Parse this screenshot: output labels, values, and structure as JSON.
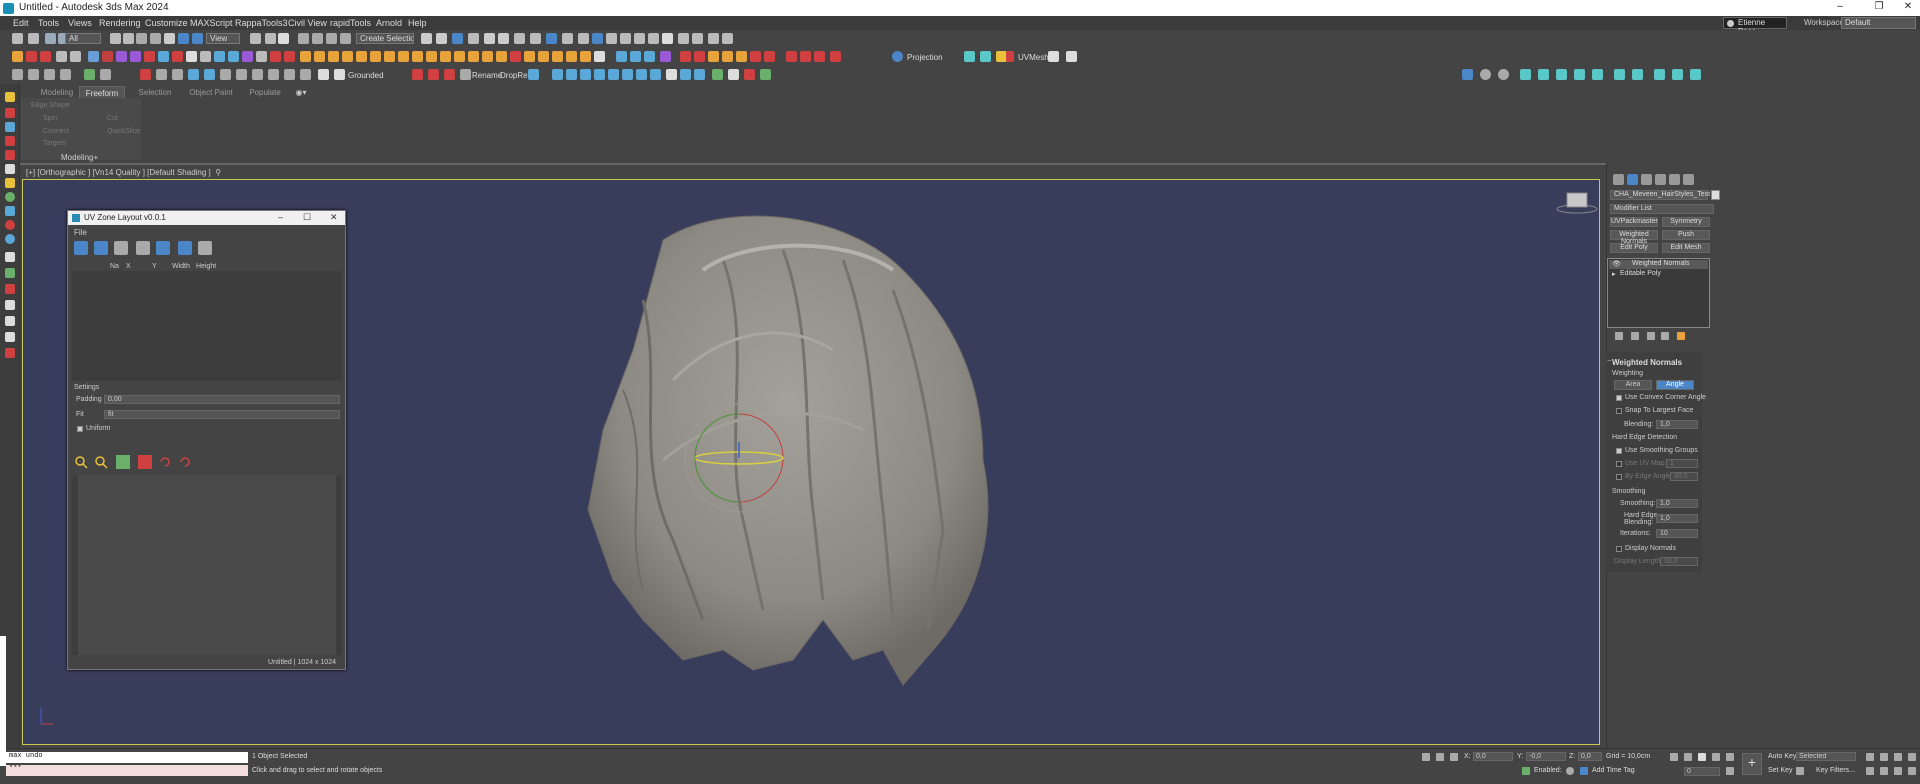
{
  "window": {
    "title": "Untitled - Autodesk 3ds Max 2024",
    "minimize": "–",
    "maximize": "❐",
    "close": "✕"
  },
  "menu": {
    "items": [
      "Edit",
      "Tools",
      "Views",
      "Rendering",
      "Customize",
      "MAXScript",
      "RappaTools3",
      "Civil View",
      "rapidTools",
      "Arnold",
      "Help"
    ],
    "user": "Etienne Besc...",
    "workspaces_label": "Workspaces:",
    "workspace": "Default"
  },
  "toolbar": {
    "filter": "All",
    "refcoord": "View",
    "selection_set": "Create Selection Se",
    "projection": "Projection",
    "uvmesh": "UVMesh",
    "grounded": "Grounded",
    "rename": "Rename",
    "dropref": "DropRef"
  },
  "ribbon": {
    "tabs": [
      "Modeling",
      "Freeform",
      "Selection",
      "Object Paint",
      "Populate"
    ],
    "active_tab": "Freeform",
    "items": [
      "Edge Shape",
      "Spin",
      "Cut",
      "Connect",
      "QuickSlice",
      "Targets"
    ],
    "footer": "Modeling+"
  },
  "viewport": {
    "label": "[+] [Orthographic ] [Vn14 Quality ] [Default Shading ]",
    "label_extra": "⚲"
  },
  "uv_window": {
    "title": "UV Zone Layout v0.0.1",
    "menu_file": "File",
    "columns": [
      "Na",
      "X",
      "Y",
      "Width",
      "Height"
    ],
    "settings_label": "Settings",
    "padding_label": "Padding",
    "padding_value": "0,00",
    "fit_label": "Fit",
    "fit_value": "fit",
    "uniform_label": "Uniform",
    "status": "Untitled | 1024 x 1024"
  },
  "command_panel": {
    "object_name": "CHA_Meveen_HairStyles_Test",
    "modifier_list": "Modifier List",
    "buttons": [
      "UVPackmaster",
      "Symmetry",
      "Weighted Normals",
      "Push",
      "Edit Poly",
      "Edit Mesh"
    ],
    "stack": [
      "Weighted Normals",
      "Editable Poly"
    ]
  },
  "weighted_normals": {
    "title": "Weighted Normals",
    "weighting": "Weighting",
    "area": "Area",
    "angle": "Angle",
    "convex": "Use Convex Corner Angle",
    "snap": "Snap To Largest Face",
    "blending_label": "Blending:",
    "blending_value": "1,0",
    "hard_edge": "Hard Edge Detection",
    "use_smoothing": "Use Smoothing Groups",
    "use_uv": "Use UV Map:",
    "use_uv_value": "1",
    "by_edge": "By Edge Angle:",
    "by_edge_value": "30,0",
    "smoothing_group": "Smoothing",
    "smoothing_label": "Smoothing:",
    "smoothing_value": "1,0",
    "hard_edge_blend_1": "Hard Edge",
    "hard_edge_blend_2": "Blending:",
    "hard_edge_blend_value": "1,0",
    "iterations_label": "Iterations:",
    "iterations_value": "10",
    "display_normals": "Display Normals",
    "display_length_label": "Display Length:",
    "display_length_value": "10,0"
  },
  "status": {
    "maxscript_line1": "max undo",
    "maxscript_line2": "***",
    "selected": "1 Object Selected",
    "prompt": "Click and drag to select and rotate objects",
    "x_label": "X:",
    "x_value": "0,0",
    "y_label": "Y:",
    "y_value": "-0,0",
    "z_label": "Z:",
    "z_value": "0,0",
    "grid": "Grid = 10,0cm",
    "enabled": "Enabled:",
    "add_time_tag": "Add Time Tag",
    "autokey": "Auto Key",
    "setkey": "Set Key",
    "selected_dd": "Selected",
    "key_filters": "Key Filters...",
    "frame": "0"
  },
  "colors": {
    "viewport_bg": "#393d5c",
    "accent_blue": "#4a86c8",
    "hair": "#8d8a84"
  }
}
